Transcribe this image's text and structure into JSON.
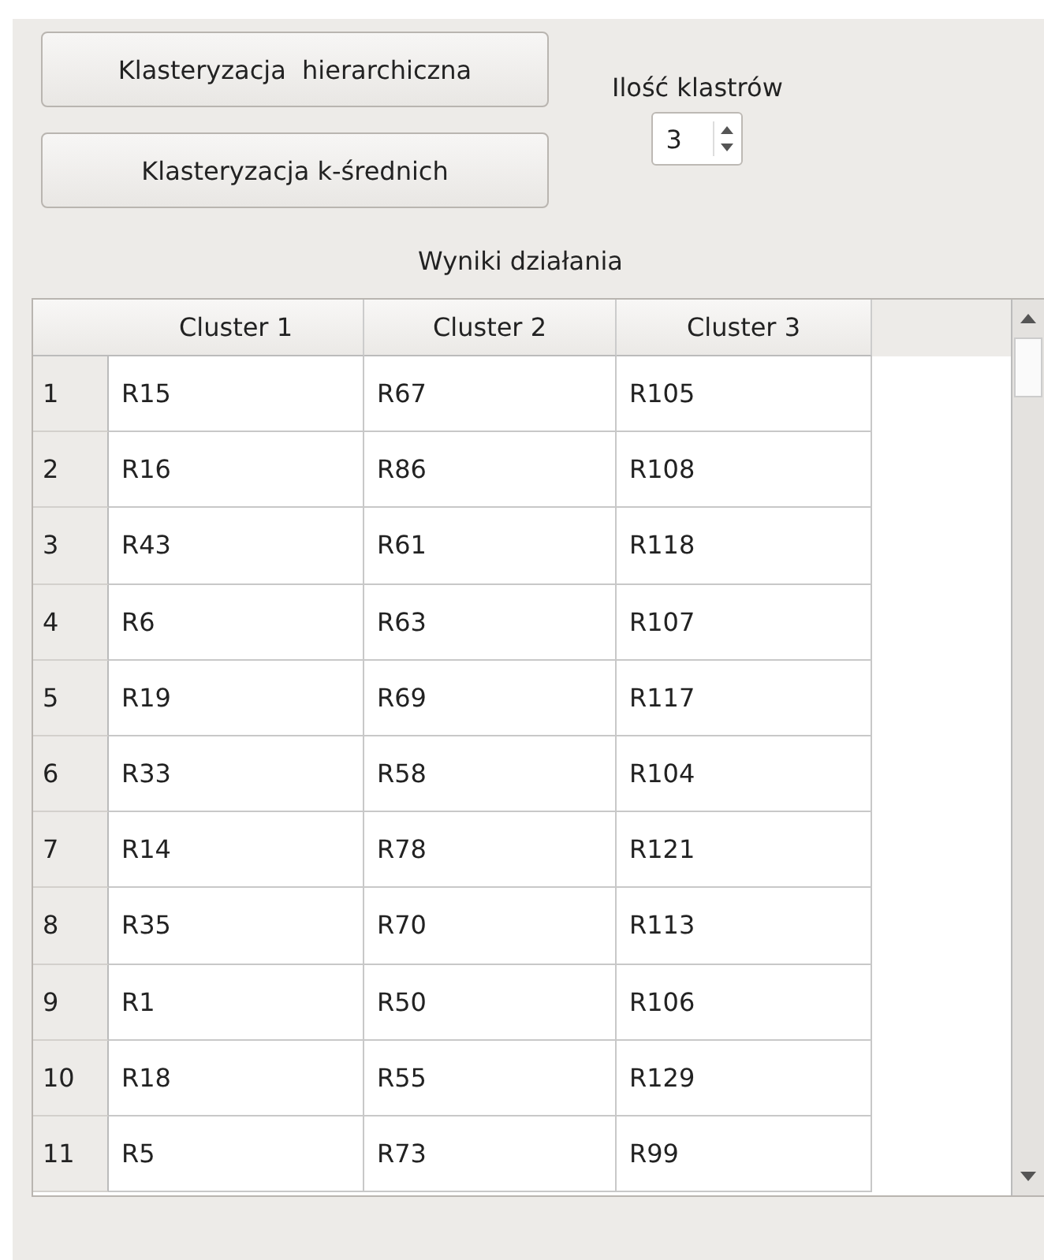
{
  "buttons": [
    {
      "label": "Klasteryzacja  hierarchiczna"
    },
    {
      "label": "Klasteryzacja k-średnich"
    }
  ],
  "cluster_count": {
    "label": "Ilość klastrów",
    "value": "3"
  },
  "results_title": "Wyniki działania",
  "table": {
    "columns": [
      "Cluster 1",
      "Cluster 2",
      "Cluster 3"
    ],
    "rows": [
      {
        "header": "1",
        "cells": [
          "R15",
          "R67",
          "R105"
        ]
      },
      {
        "header": "2",
        "cells": [
          "R16",
          "R86",
          "R108"
        ]
      },
      {
        "header": "3",
        "cells": [
          "R43",
          "R61",
          "R118"
        ]
      },
      {
        "header": "4",
        "cells": [
          "R6",
          "R63",
          "R107"
        ]
      },
      {
        "header": "5",
        "cells": [
          "R19",
          "R69",
          "R117"
        ]
      },
      {
        "header": "6",
        "cells": [
          "R33",
          "R58",
          "R104"
        ]
      },
      {
        "header": "7",
        "cells": [
          "R14",
          "R78",
          "R121"
        ]
      },
      {
        "header": "8",
        "cells": [
          "R35",
          "R70",
          "R113"
        ]
      },
      {
        "header": "9",
        "cells": [
          "R1",
          "R50",
          "R106"
        ]
      },
      {
        "header": "10",
        "cells": [
          "R18",
          "R55",
          "R129"
        ]
      },
      {
        "header": "11",
        "cells": [
          "R5",
          "R73",
          "R99"
        ]
      }
    ]
  }
}
